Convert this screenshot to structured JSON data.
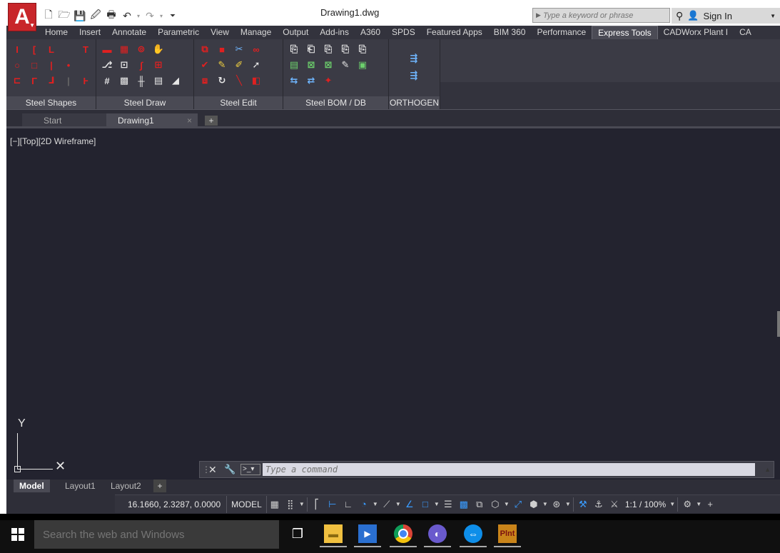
{
  "window": {
    "title": "Drawing1.dwg",
    "app_logo_letter": "A"
  },
  "search": {
    "placeholder": "Type a keyword or phrase",
    "signin": "Sign In"
  },
  "ribbon_tabs": [
    "Home",
    "Insert",
    "Annotate",
    "Parametric",
    "View",
    "Manage",
    "Output",
    "Add-ins",
    "A360",
    "SPDS",
    "Featured Apps",
    "BIM 360",
    "Performance",
    "Express Tools",
    "CADWorx Plant I",
    "CA"
  ],
  "active_ribbon_tab": "Express Tools",
  "panels": {
    "steel_shapes": "Steel Shapes",
    "steel_draw": "Steel Draw",
    "steel_edit": "Steel Edit",
    "steel_bom": "Steel BOM / DB",
    "orthogen": "ORTHOGEN"
  },
  "doc_tabs": {
    "start": "Start",
    "drawing": "Drawing1",
    "close": "×",
    "new": "+"
  },
  "viewport": {
    "label": "[−][Top][2D Wireframe]",
    "ucs_y": "Y",
    "ucs_x": "X"
  },
  "command_line": {
    "placeholder": "Type a command"
  },
  "layout_tabs": {
    "model": "Model",
    "layout1": "Layout1",
    "layout2": "Layout2",
    "add": "+"
  },
  "status_bar": {
    "coordinates": "16.1660, 2.3287, 0.0000",
    "model": "MODEL",
    "scale": "1:1 / 100%"
  },
  "taskbar": {
    "search_placeholder": "Search the web and Windows",
    "plnt_label": "Plnt"
  },
  "colors": {
    "accent_red": "#c8262a",
    "viewport_bg": "#23232f",
    "ribbon_bg": "#3b3b45",
    "status_blue": "#3a9cff"
  }
}
